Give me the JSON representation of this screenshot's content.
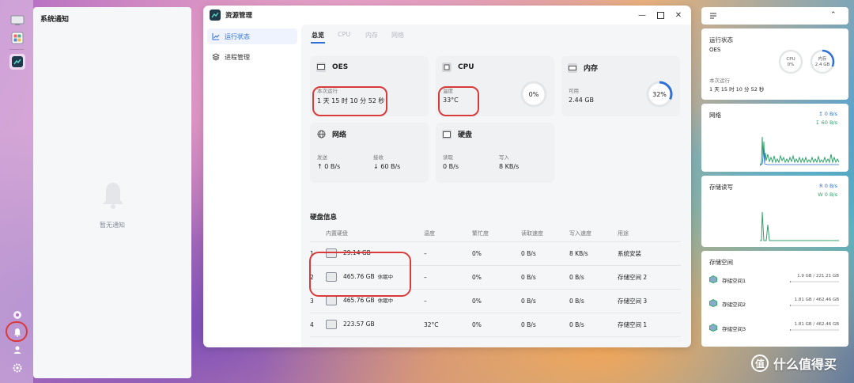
{
  "colors": {
    "accent": "#2f6fd8",
    "highlight": "#d93b3b",
    "green": "#2fa36b"
  },
  "notifications": {
    "title": "系统通知",
    "empty_text": "暂无通知"
  },
  "window": {
    "title": "资源管理",
    "sidebar": [
      {
        "label": "运行状态",
        "icon": "chart-line-icon",
        "active": true
      },
      {
        "label": "进程管理",
        "icon": "layers-icon",
        "active": false
      }
    ],
    "tabs": [
      {
        "label": "总览",
        "active": true
      },
      {
        "label": "CPU",
        "active": false
      },
      {
        "label": "内存",
        "active": false
      },
      {
        "label": "网络",
        "active": false
      }
    ],
    "cards": {
      "oes": {
        "title": "OES",
        "label": "本次运行",
        "value": "1 天 15 时 10 分 52 秒"
      },
      "cpu": {
        "title": "CPU",
        "label": "温度",
        "value": "33°C",
        "ring_text": "0%",
        "usage": 0
      },
      "mem": {
        "title": "内存",
        "label": "可用",
        "value": "2.44 GB",
        "ring_text": "32%",
        "usage": 0.32
      },
      "net": {
        "title": "网络",
        "send_label": "发送",
        "send_value": "↑ 0 B/s",
        "recv_label": "接收",
        "recv_value": "↓ 60 B/s"
      },
      "disk": {
        "title": "硬盘",
        "read_label": "读取",
        "read_value": "0 B/s",
        "write_label": "写入",
        "write_value": "8 KB/s"
      }
    },
    "disk_info": {
      "title": "硬盘信息",
      "headers": [
        "",
        "内置硬盘",
        "温度",
        "繁忙度",
        "读取速度",
        "写入速度",
        "用途"
      ],
      "rows": [
        {
          "index": "1",
          "size": "29.14 GB",
          "status": "",
          "temp": "–",
          "busy": "0%",
          "read": "0 B/s",
          "write": "8 KB/s",
          "use": "系统安装"
        },
        {
          "index": "2",
          "size": "465.76 GB",
          "status": "休眠中",
          "temp": "–",
          "busy": "0%",
          "read": "0 B/s",
          "write": "0 B/s",
          "use": "存储空间 2"
        },
        {
          "index": "3",
          "size": "465.76 GB",
          "status": "休眠中",
          "temp": "–",
          "busy": "0%",
          "read": "0 B/s",
          "write": "0 B/s",
          "use": "存储空间 3"
        },
        {
          "index": "4",
          "size": "223.57 GB",
          "status": "",
          "temp": "32°C",
          "busy": "0%",
          "read": "0 B/s",
          "write": "0 B/s",
          "use": "存储空间 1"
        }
      ]
    }
  },
  "widgets": {
    "status": {
      "title": "运行状态",
      "name": "OES",
      "cpu_label": "CPU",
      "cpu_value": "0%",
      "mem_label": "内存",
      "mem_value": "2.4 GB",
      "uptime_label": "本次运行",
      "uptime_value": "1 天 15 时 10 分 52 秒"
    },
    "network": {
      "title": "网络",
      "up": "0 B/s",
      "down": "60 B/s"
    },
    "storage_io": {
      "title": "存储读写",
      "read": "R 0 B/s",
      "write": "W 0 B/s"
    },
    "storage": {
      "title": "存储空间",
      "items": [
        {
          "name": "存储空间1",
          "usage": "1.9 GB / 221.21 GB",
          "fraction": 0.01
        },
        {
          "name": "存储空间2",
          "usage": "1.81 GB / 462.46 GB",
          "fraction": 0.004
        },
        {
          "name": "存储空间3",
          "usage": "1.81 GB / 462.46 GB",
          "fraction": 0.004
        }
      ]
    }
  },
  "watermark": {
    "text": "什么值得买",
    "icon": "值"
  }
}
